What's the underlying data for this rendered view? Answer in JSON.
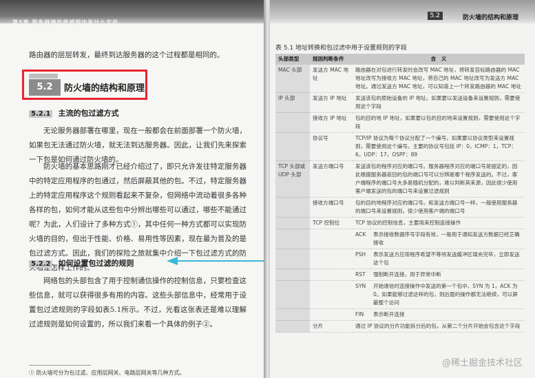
{
  "left_page": {
    "header": "第5章 服务器端的局域网中有什么玄机",
    "intro": "路由器的层层转发，最终到达服务器的这个过程都是相同的。",
    "section": {
      "num": "5.2",
      "title": "防火墙的结构和原理"
    },
    "sub1": {
      "num": "5.2.1",
      "title": "主流的包过滤方式"
    },
    "para1": "无论服务器部署在哪里，现在一般都会在前面部署一个防火墙，如果包无法通过防火墙，就无法到达服务器。因此，让我们先来探索一下包是如何通过防火墙的。",
    "para2": "防火墙的基本思路刚才已经介绍过了，即只允许发往特定服务器中的特定应用程序的包通过，然后屏蔽其他的包。不过，特定服务器上的特定应用程序这个规则看起来不复杂，但网络中流动着很多各种各样的包，如何才能从这些包中分辨出哪些可以通过，哪些不能通过呢？为此，人们设计了多种方式①，其中任何一种方式都可以实现防火墙的目的，但出于性能、价格、易用性等因素，现在最为普及的是包过滤方式。因此，我们的探险之旅就集中介绍一下包过滤方式的防火墙是怎样工作的。",
    "sub2": {
      "num": "5.2.2",
      "title": "如何设置包过滤的规则"
    },
    "para3": "网络包的头部包含了用于控制通信操作的控制信息，只要检查这些信息，就可以获得很多有用的内容。这些头部信息中，经常用于设置包过滤规则的字段如表5.1所示。不过，光看这张表还是难以理解过滤规则是如何设置的，所以我们来看一个具体的例子②。",
    "footnote": "①  防火墙可分为包过滤、应用层网关、电路层网关等几种方式。"
  },
  "right_page": {
    "header_num": "5.2",
    "header_title": "防火墙的结构和原理",
    "table_caption": "表 5.1   地址转换和包过滤中用于设置规则的字段",
    "columns": [
      "头部类型",
      "规则判断条件",
      "含　义"
    ],
    "rows": [
      {
        "c1": "MAC 头部",
        "c2": "发送方 MAC 地址",
        "k": "",
        "c3": "路由器在对包进行转发时会改写 MAC 地址，将转发目标路由器的 MAC 地址改写为接收方 MAC 地址，将自己的 MAC 地址改写为发送方 MAC 地址。通过发送方 MAC 地址，可以知道上一个转发路由器的 MAC 地址"
      },
      {
        "c1": "IP 头部",
        "c2": "发送方 IP 地址",
        "k": "",
        "c3": "发送该包的原始设备的 IP 地址。如果要以发送设备来设置规则，需要使用这个字段"
      },
      {
        "c1": "",
        "c2": "接收方 IP 地址",
        "k": "",
        "c3": "包的目的地 IP 地址，如果要以包的目的地来设置规则，需要使用这个字段"
      },
      {
        "c1": "",
        "c2": "协议号",
        "k": "",
        "c3": "TCP/IP 协议为每个协议分配了一个编号，如果要以协议类型来设置规则，需要使用这个编号。主要的协议号包括 IP：0，ICMP：1，TCP：6，UDP：17，OSPF：89"
      },
      {
        "c1": "TCP 头部或 UDP 头部",
        "c2": "发送方端口号",
        "k": "",
        "c3": "发送该包的程序对应的端口号。服务器程序对应的端口号是固定的，因此根据服务器返回的包的端口号可以分辨是哪个程序发送的。不过，客户端程序的端口号大多是随机分配的，难以判断其来源，因此很少使用客户端发送的包的端口号来设置过滤规则"
      },
      {
        "c1": "",
        "c2": "接收方端口号",
        "k": "",
        "c3": "包的目的地程序对应的端口号。和发送方端口号一样，一般使用服务器的端口号来设置规则，很少使用客户端的端口号"
      },
      {
        "c1": "",
        "c2": "TCP 控制位",
        "k": "",
        "c3": "TCP 协议的控制信息，主要用来控制连接操作"
      },
      {
        "c1": "",
        "c2": "",
        "k": "ACK",
        "c3": "表示接收数据序号字段有效，一般用于通知发送方数据已经正确接收"
      },
      {
        "c1": "",
        "c2": "",
        "k": "PSH",
        "c3": "表示发送方应用程序希望不等待发送缓冲区填充完毕，立即发送这个包"
      },
      {
        "c1": "",
        "c2": "",
        "k": "RST",
        "c3": "强制断开连接，用于异常中断"
      },
      {
        "c1": "",
        "c2": "",
        "k": "SYN",
        "c3": "开始通信时连接操作中发送的第一个包中，SYN 为 1，ACK 为 0。如果能够过滤这样的包，则后面的操作都无法继续，可以屏蔽整个访问"
      },
      {
        "c1": "",
        "c2": "",
        "k": "FIN",
        "c3": "表示断开连接"
      },
      {
        "c1": "",
        "c2": "分片",
        "k": "",
        "c3": "通过 IP 协议的分片功能拆分后的包，从第二个分片开始会包含这个字段"
      }
    ],
    "watermark": "@稀土掘金技术社区"
  }
}
